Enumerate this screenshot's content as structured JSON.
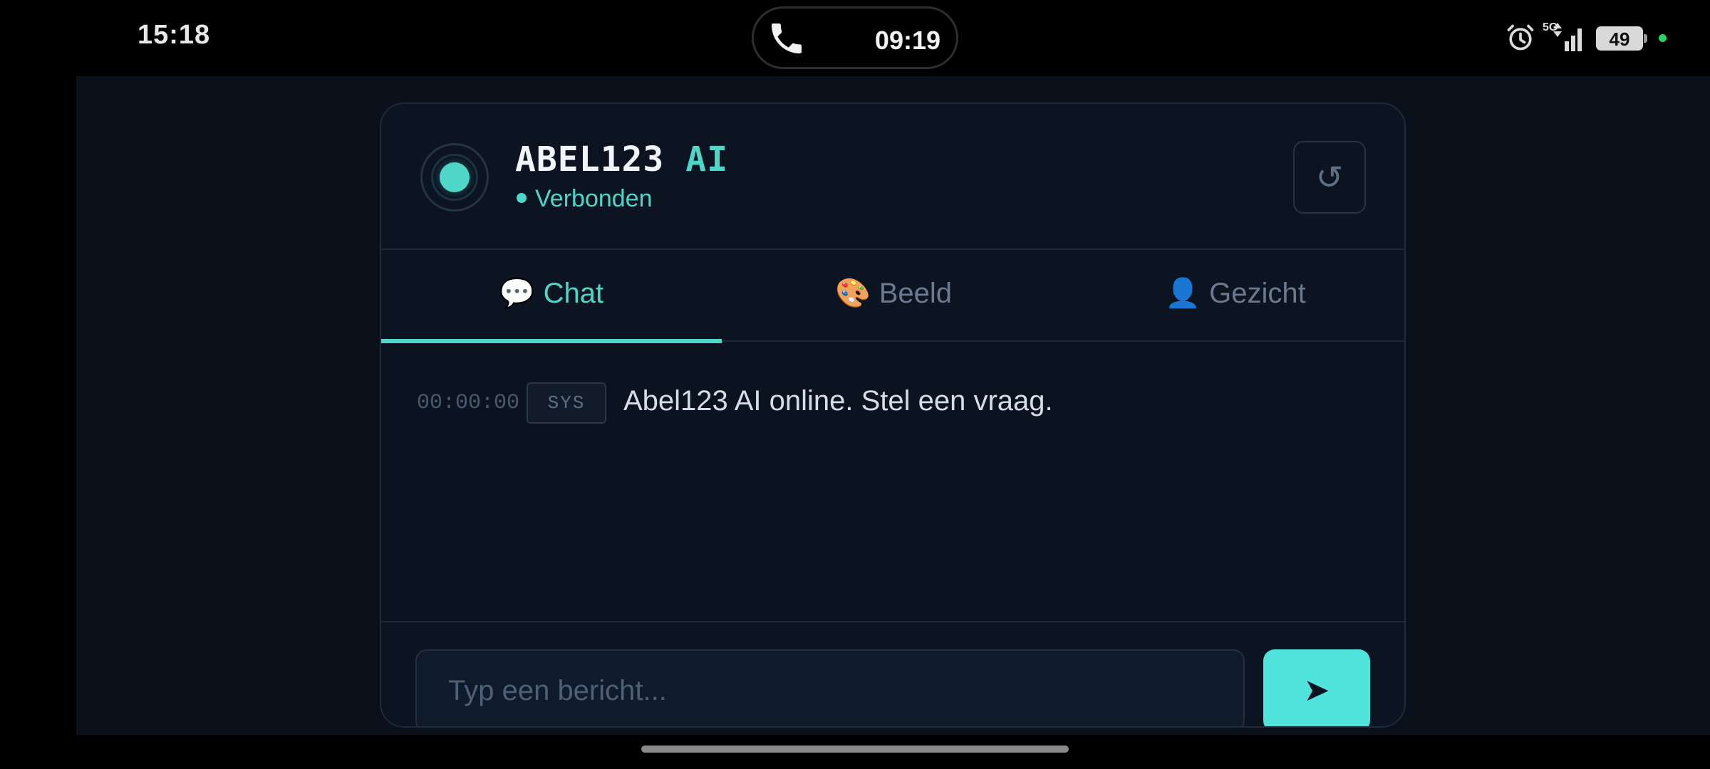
{
  "status_bar": {
    "time": "15:18",
    "call_time": "09:19",
    "network": "5G",
    "battery": "49",
    "icons": [
      "phone-icon",
      "alarm-icon",
      "signal-icon",
      "battery-icon"
    ]
  },
  "header": {
    "title_main": "ABEL123",
    "title_accent": "AI",
    "status": "Verbonden",
    "reset_icon": "↺"
  },
  "tabs": [
    {
      "emoji": "💬",
      "label": "Chat",
      "active": true
    },
    {
      "emoji": "🎨",
      "label": "Beeld",
      "active": false
    },
    {
      "emoji": "👤",
      "label": "Gezicht",
      "active": false
    }
  ],
  "messages": [
    {
      "timestamp": "00:00:00",
      "sender": "SYS",
      "text": "Abel123 AI online. Stel een vraag."
    }
  ],
  "composer": {
    "placeholder": "Typ een bericht...",
    "send_icon": "➤"
  },
  "colors": {
    "accent": "#4fd6c9",
    "background": "#0a111b",
    "panel": "#0c1422"
  }
}
